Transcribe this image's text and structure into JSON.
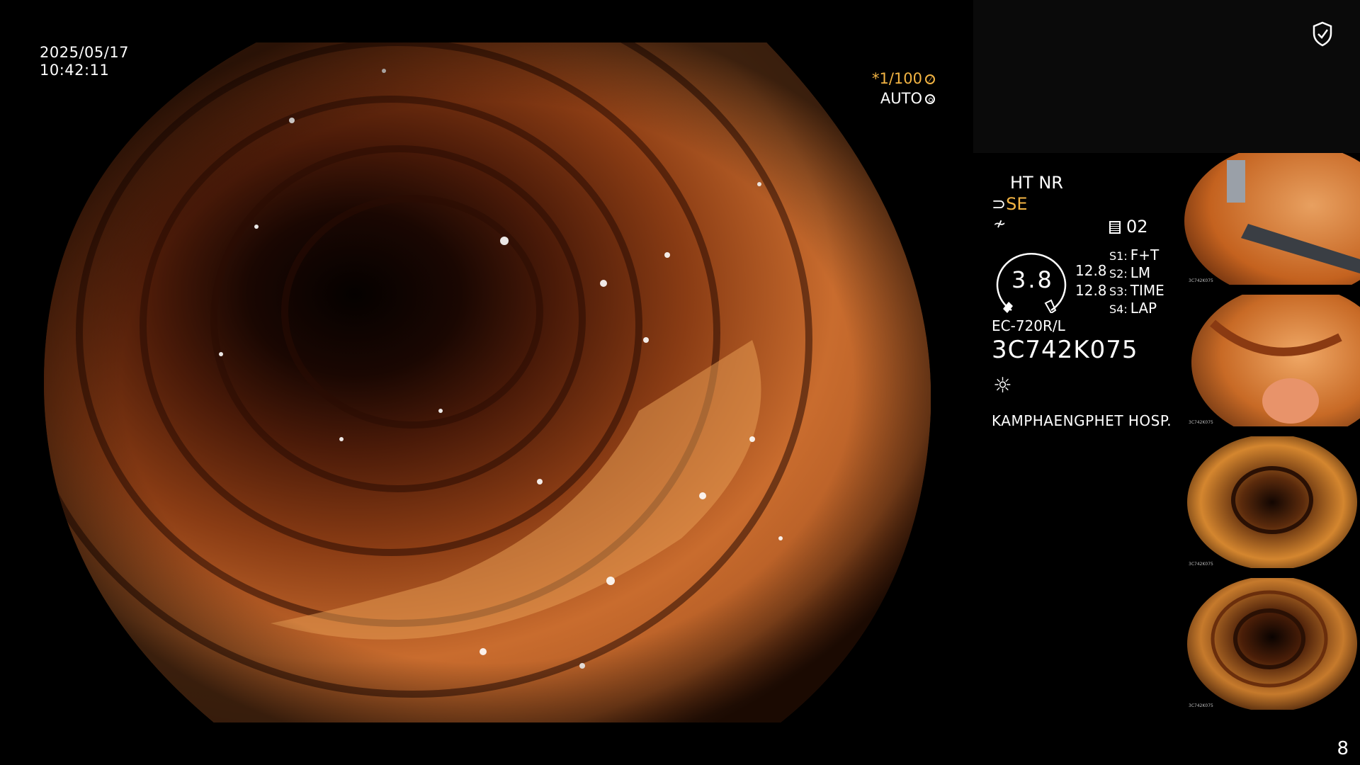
{
  "datetime": {
    "date": "2025/05/17",
    "time": "10:42:11"
  },
  "camera": {
    "shutter": "*1/100",
    "iris": "AUTO"
  },
  "status": {
    "ht_nr": "HT NR",
    "enhancement": "SE",
    "image_count": "02",
    "gauge_value": "3.8",
    "value_a": "12.8",
    "value_b": "12.8",
    "switches": [
      {
        "key": "S1:",
        "value": "F+T"
      },
      {
        "key": "S2:",
        "value": "LM"
      },
      {
        "key": "S3:",
        "value": "TIME"
      },
      {
        "key": "S4:",
        "value": "LAP"
      }
    ],
    "scope_model": "EC-720R/L",
    "scope_serial": "3C742K075",
    "hospital": "KAMPHAENGPHET HOSP."
  },
  "thumbnails": [
    {
      "caption": "3C742K075"
    },
    {
      "caption": "3C742K075"
    },
    {
      "caption": "3C742K075"
    },
    {
      "caption": "3C742K075"
    }
  ],
  "page_number": "8",
  "colors": {
    "accent_orange": "#f3b443",
    "tissue_light": "#e08a3c",
    "tissue_mid": "#a94e1c",
    "tissue_dark": "#2a0d04"
  },
  "icons": [
    "shield-check-icon",
    "shutter-icon",
    "iris-icon",
    "light-icon",
    "document-icon"
  ]
}
